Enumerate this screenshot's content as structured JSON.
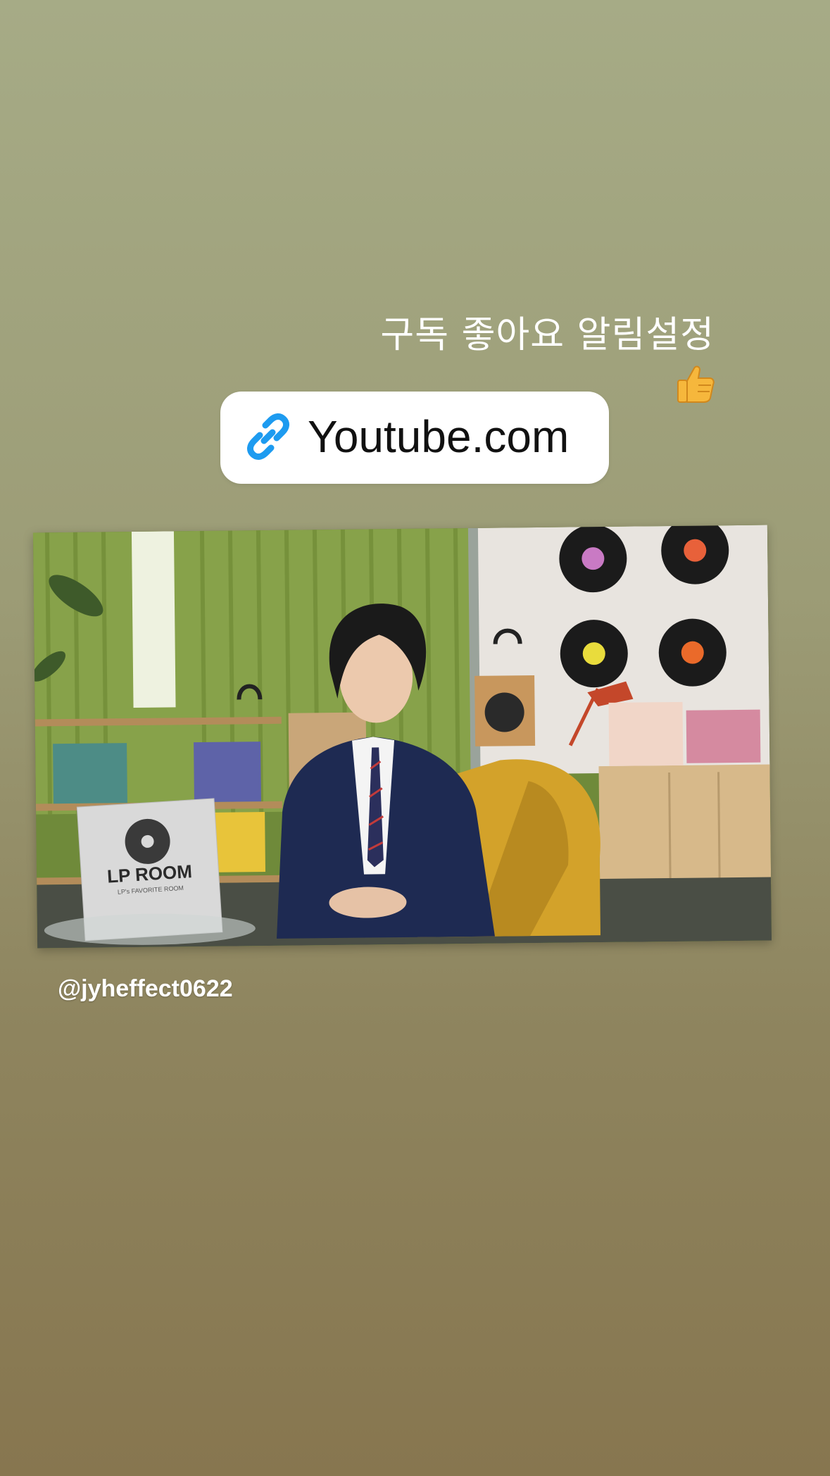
{
  "story": {
    "caption": "구독 좋아요 알림설정",
    "emoji_icon": "thumbs-up-icon",
    "link_sticker": {
      "icon": "link-icon",
      "label": "Youtube.com",
      "icon_color": "#1d9bf0"
    },
    "photo": {
      "sign_title": "LP ROOM",
      "sign_subtitle": "LP's FAVORITE ROOM"
    },
    "mention": "@jyheffect0622"
  },
  "colors": {
    "background_top": "#a6ab86",
    "background_bottom": "#87764f",
    "sticker_background": "#ffffff",
    "text": "#ffffff"
  }
}
